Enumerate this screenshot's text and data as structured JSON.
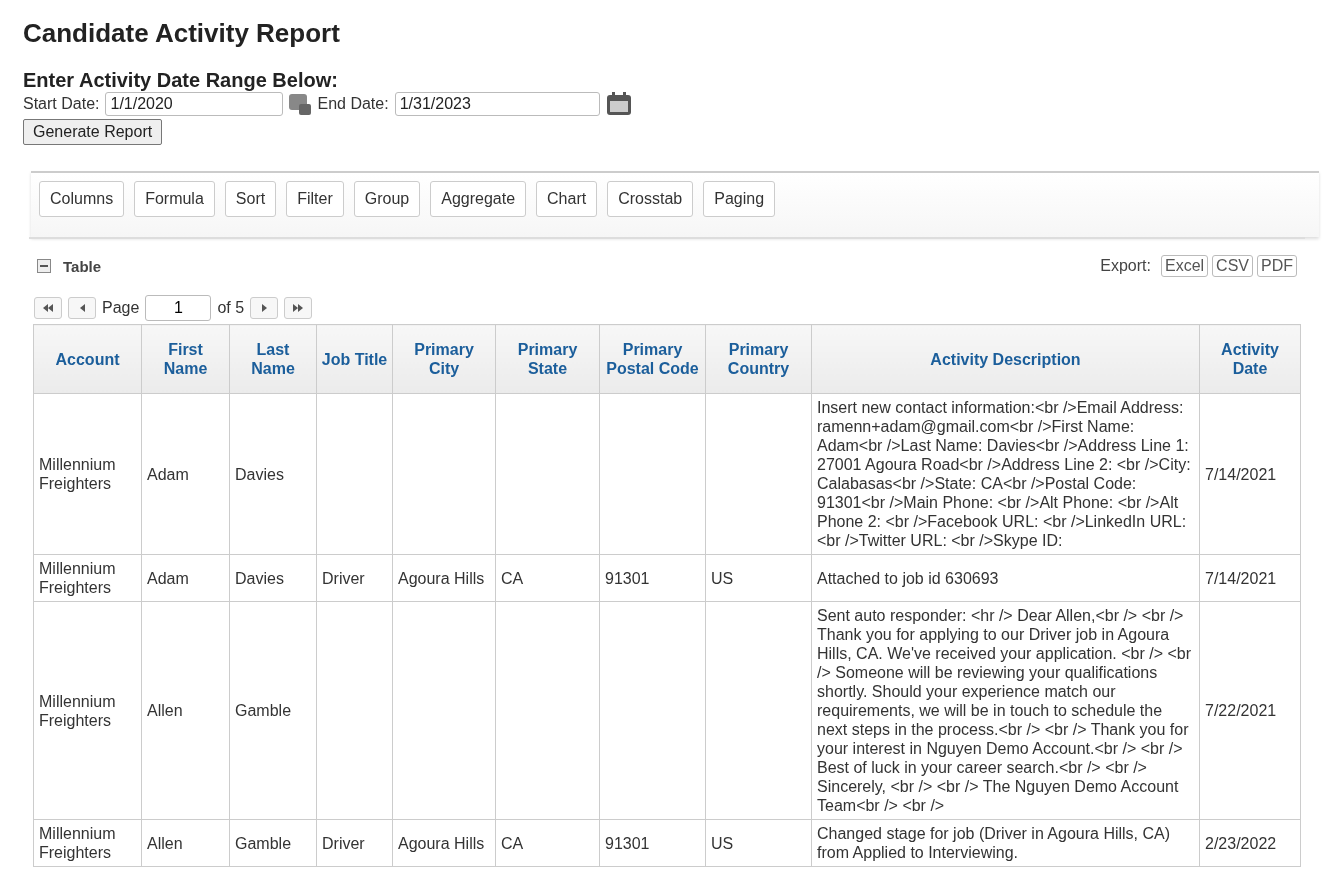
{
  "title": "Candidate Activity Report",
  "date_range": {
    "heading": "Enter Activity Date Range Below:",
    "start_label": "Start Date:",
    "start_value": "1/1/2020",
    "end_label": "End Date:",
    "end_value": "1/31/2023",
    "generate_button": "Generate Report"
  },
  "toolbar": [
    "Columns",
    "Formula",
    "Sort",
    "Filter",
    "Group",
    "Aggregate",
    "Chart",
    "Crosstab",
    "Paging"
  ],
  "section": {
    "title": "Table",
    "expanded": true,
    "export_label": "Export:",
    "export_buttons": [
      "Excel",
      "CSV",
      "PDF"
    ]
  },
  "pager": {
    "label": "Page",
    "value": "1",
    "total": "of 5"
  },
  "table": {
    "columns": [
      "Account",
      "First Name",
      "Last Name",
      "Job Title",
      "Primary City",
      "Primary State",
      "Primary Postal Code",
      "Primary Country",
      "Activity Description",
      "Activity Date"
    ],
    "rows": [
      [
        "Millennium Freighters",
        "Adam",
        "Davies",
        "",
        "",
        "",
        "",
        "",
        "Insert new contact information:<br />Email Address: ramenn+adam@gmail.com<br />First Name: Adam<br />Last Name: Davies<br />Address Line 1: 27001 Agoura Road<br />Address Line 2: <br />City: Calabasas<br />State: CA<br />Postal Code: 91301<br />Main Phone: <br />Alt Phone: <br />Alt Phone 2: <br />Facebook URL: <br />LinkedIn URL: <br />Twitter URL: <br />Skype ID:",
        "7/14/2021"
      ],
      [
        "Millennium Freighters",
        "Adam",
        "Davies",
        "Driver",
        "Agoura Hills",
        "CA",
        "91301",
        "US",
        "Attached to job id 630693",
        "7/14/2021"
      ],
      [
        "Millennium Freighters",
        "Allen",
        "Gamble",
        "",
        "",
        "",
        "",
        "",
        "Sent auto responder: <hr /> Dear Allen,<br /> <br /> Thank you for applying to our Driver job in Agoura Hills, CA. We've received your application. <br /> <br /> Someone will be reviewing your qualifications shortly. Should your experience match our requirements, we will be in touch to schedule the next steps in the process.<br /> <br /> Thank you for your interest in Nguyen Demo Account.<br /> <br /> Best of luck in your career search.<br /> <br /> Sincerely, <br /> <br /> The Nguyen Demo Account Team<br /> <br />",
        "7/22/2021"
      ],
      [
        "Millennium Freighters",
        "Allen",
        "Gamble",
        "Driver",
        "Agoura Hills",
        "CA",
        "91301",
        "US",
        "Changed stage for job (Driver in Agoura Hills, CA) from Applied to Interviewing.",
        "2/23/2022"
      ]
    ]
  }
}
